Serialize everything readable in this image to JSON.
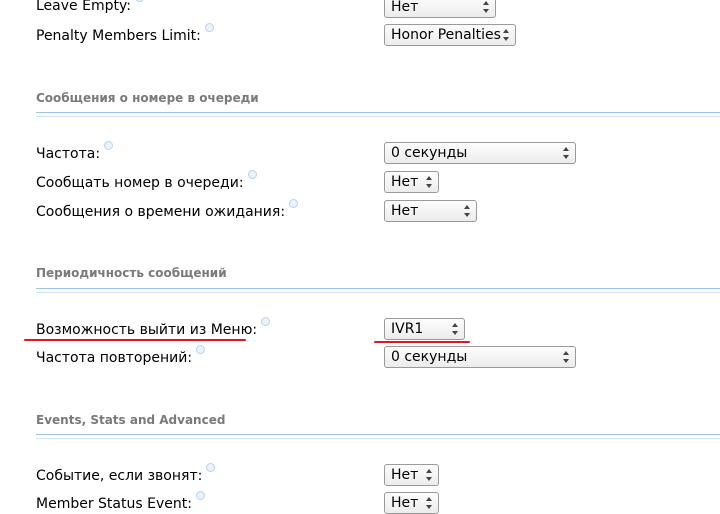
{
  "queue_settings": {
    "leave_empty": {
      "label": "Leave Empty:",
      "value": "Нет"
    },
    "penalty_members_limit": {
      "label": "Penalty Members Limit:",
      "value": "Honor Penalties"
    }
  },
  "announce_position_section": {
    "title": "Сообщения о номере в очереди",
    "frequency": {
      "label": "Частота:",
      "value": "0 секунды"
    },
    "announce_position": {
      "label": "Сообщать номер в очереди:",
      "value": "Нет"
    },
    "announce_holdtime": {
      "label": "Сообщения о времени ожидания:",
      "value": "Нет"
    }
  },
  "periodic_announce_section": {
    "title": "Периодичность сообщений",
    "ivr_breakout": {
      "label": "Возможность выйти из Меню:",
      "value": "IVR1"
    },
    "repeat_frequency": {
      "label": "Частота повторений:",
      "value": "0 секунды"
    }
  },
  "events_section": {
    "title": "Events, Stats and Advanced",
    "event_when_called": {
      "label": "Событие, если звонят:",
      "value": "Нет"
    },
    "member_status_event": {
      "label": "Member Status Event:",
      "value": "Нет"
    }
  },
  "colors": {
    "annotation_underline": "#e3161c",
    "divider": "#9fc3e6",
    "section_title": "#7a7a7a"
  }
}
